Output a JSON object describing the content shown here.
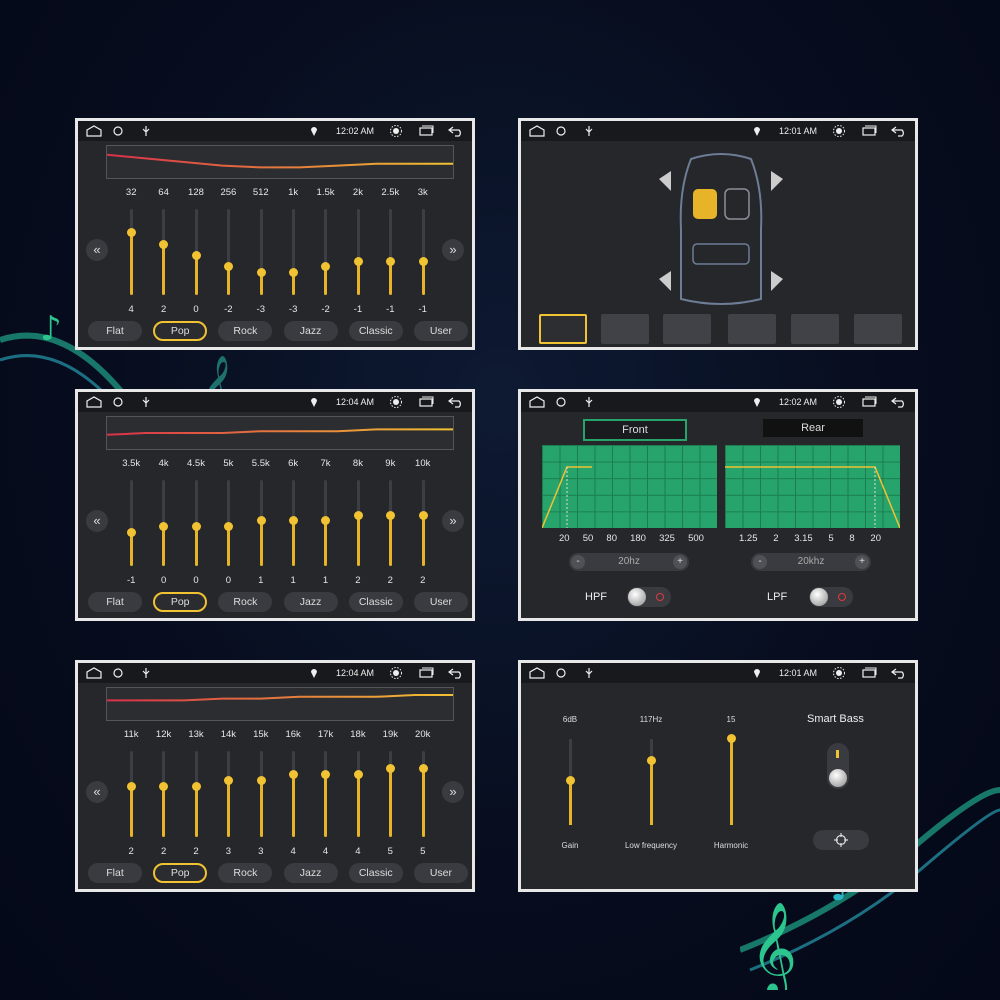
{
  "statusbar": {
    "times": [
      "12:02 AM",
      "12:01 AM",
      "12:04 AM",
      "12:02 AM",
      "12:04 AM",
      "12:01 AM"
    ]
  },
  "eq": {
    "panels": [
      {
        "freqs": [
          "32",
          "64",
          "128",
          "256",
          "512",
          "1k",
          "1.5k",
          "2k",
          "2.5k",
          "3k"
        ],
        "values": [
          "4",
          "2",
          "0",
          "-2",
          "-3",
          "-3",
          "-2",
          "-1",
          "-1",
          "-1"
        ]
      },
      {
        "freqs": [
          "3.5k",
          "4k",
          "4.5k",
          "5k",
          "5.5k",
          "6k",
          "7k",
          "8k",
          "9k",
          "10k"
        ],
        "values": [
          "-1",
          "0",
          "0",
          "0",
          "1",
          "1",
          "1",
          "2",
          "2",
          "2"
        ]
      },
      {
        "freqs": [
          "11k",
          "12k",
          "13k",
          "14k",
          "15k",
          "16k",
          "17k",
          "18k",
          "19k",
          "20k"
        ],
        "values": [
          "2",
          "2",
          "2",
          "3",
          "3",
          "4",
          "4",
          "4",
          "5",
          "5"
        ]
      }
    ],
    "presets": [
      "Flat",
      "Pop",
      "Rock",
      "Jazz",
      "Classic",
      "User"
    ],
    "active_preset": "Pop",
    "prev_icon": "double-chevron-left-icon",
    "next_icon": "double-chevron-right-icon"
  },
  "crossover": {
    "front_label": "Front",
    "rear_label": "Rear",
    "front_ticks": [
      "20",
      "50",
      "80",
      "180",
      "325",
      "500"
    ],
    "rear_ticks": [
      "1.25",
      "2",
      "3.15",
      "5",
      "8",
      "20"
    ],
    "hpf_value": "20hz",
    "lpf_value": "20khz",
    "minus": "-",
    "plus": "+",
    "hpf_label": "HPF",
    "lpf_label": "LPF"
  },
  "gain": {
    "gain_value": "6dB",
    "lowfreq_value": "117Hz",
    "harmonic_value": "15",
    "gain_label": "Gain",
    "lowfreq_label": "Low frequency",
    "harmonic_label": "Harmonic",
    "smart_bass_label": "Smart Bass"
  },
  "colors": {
    "accent": "#f1c232",
    "graph_green": "#27a46b",
    "panel_bg": "#26272b"
  }
}
